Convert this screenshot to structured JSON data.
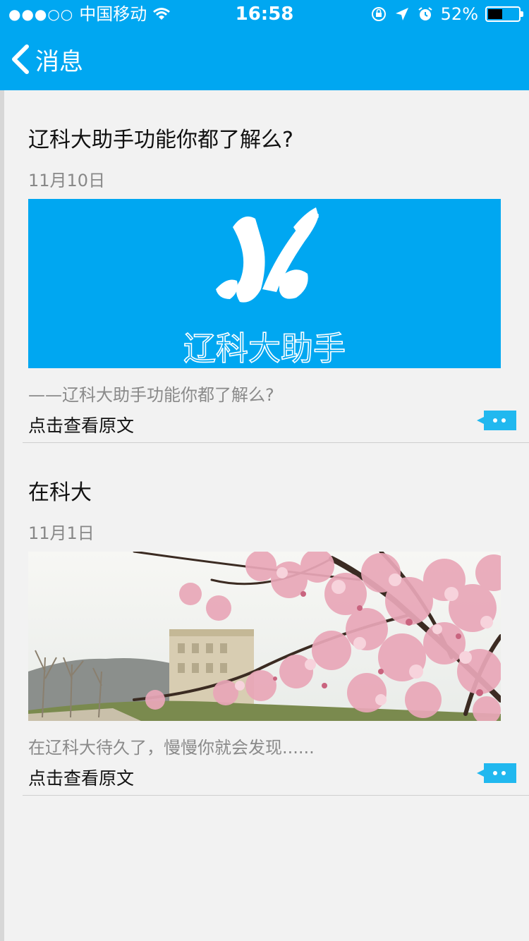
{
  "status_bar": {
    "signal": "●●●○○",
    "carrier": "中国移动",
    "time": "16:58",
    "battery_percent": "52%",
    "battery_fill_fraction": 0.52
  },
  "nav": {
    "title": "消息"
  },
  "articles": [
    {
      "title": "辽科大助手功能你都了解么?",
      "date": "11月10日",
      "image_caption": "辽科大助手",
      "summary": "——辽科大助手功能你都了解么?",
      "link": "点击查看原文"
    },
    {
      "title": "在科大",
      "date": "11月1日",
      "summary": "在辽科大待久了，慢慢你就会发现......",
      "link": "点击查看原文"
    }
  ],
  "colors": {
    "brand_blue": "#00a7f1",
    "comment_badge": "#21b8ef",
    "background": "#f2f2f2"
  }
}
